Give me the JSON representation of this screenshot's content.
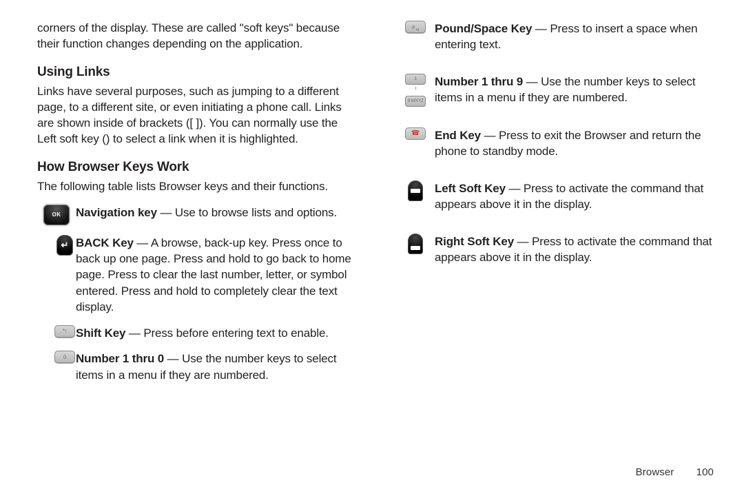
{
  "left": {
    "intro": "corners of the display. These are called \"soft keys\" because their function changes depending on the application.",
    "section1_heading": "Using Links",
    "section1_body": "Links have several purposes, such as jumping to a different page, to a different site, or even initiating a phone call. Links are shown inside of brackets ([ ]). You can normally use the Left soft key () to select a link when it is highlighted.",
    "section2_heading": "How Browser Keys Work",
    "section2_body": "The following table lists Browser keys and their functions.",
    "keys": {
      "nav": {
        "name": "Navigation key",
        "desc": " — Use to browse lists and options."
      },
      "back": {
        "name": "BACK Key",
        "desc": " — A browse, back-up key. Press once to back up one page. Press and hold to go back to home page. Press to clear the last number, letter, or symbol entered. Press and hold to completely clear the text display."
      },
      "shift": {
        "name": "Shift Key",
        "desc": " — Press before entering text to enable."
      },
      "num10": {
        "name": "Number 1 thru 0",
        "desc": " — Use the number keys to select items in a menu if they are numbered."
      }
    }
  },
  "right": {
    "keys": {
      "pound": {
        "name": "Pound/Space Key",
        "desc": " — Press to insert a space when entering text."
      },
      "num19": {
        "name": "Number 1 thru 9",
        "desc": " — Use the number keys to select items in a menu if they are numbered."
      },
      "end": {
        "name": "End Key",
        "desc": " — Press to exit the Browser and return the phone to standby mode."
      },
      "lsk": {
        "name": "Left Soft Key",
        "desc": " — Press to activate the command that appears above it in the display."
      },
      "rsk": {
        "name": "Right Soft Key",
        "desc": " — Press to activate the command that appears above it in the display."
      }
    }
  },
  "footer": {
    "section": "Browser",
    "page": "100"
  },
  "icons": {
    "ok_label": "OK",
    "back_glyph": "←",
    "shift_label": "*↑",
    "num0_label": "0  ",
    "pound_label": "# ␣",
    "num1_label": "1  ",
    "num9_label": "9 WXYZ",
    "end_glyph": "☎"
  }
}
